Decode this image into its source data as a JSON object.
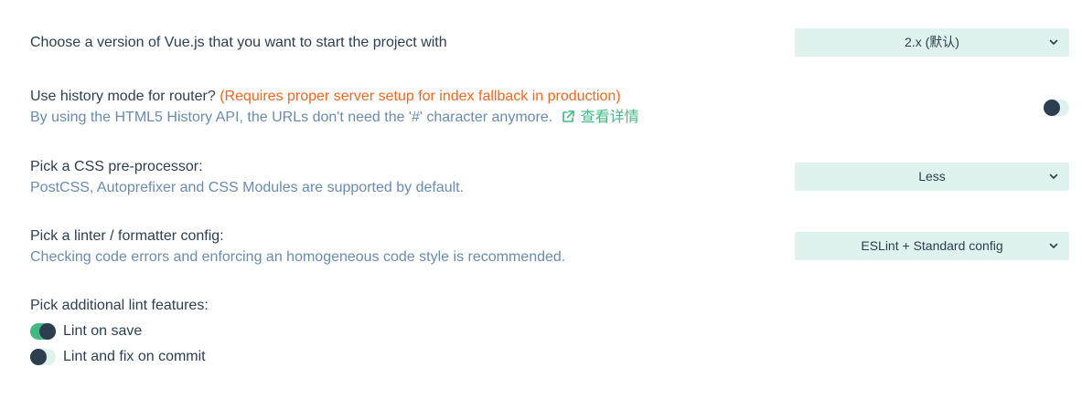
{
  "vue_version": {
    "label": "Choose a version of Vue.js that you want to start the project with",
    "selected": "2.x (默认)"
  },
  "history_mode": {
    "label": "Use history mode for router?",
    "warning": "(Requires proper server setup for index fallback in production)",
    "description": "By using the HTML5 History API, the URLs don't need the '#' character anymore.",
    "link_text": "查看详情",
    "enabled": false
  },
  "css_preprocessor": {
    "label": "Pick a CSS pre-processor:",
    "description": "PostCSS, Autoprefixer and CSS Modules are supported by default.",
    "selected": "Less"
  },
  "linter": {
    "label": "Pick a linter / formatter config:",
    "description": "Checking code errors and enforcing an homogeneous code style is recommended.",
    "selected": "ESLint + Standard config"
  },
  "lint_features": {
    "label": "Pick additional lint features:",
    "options": [
      {
        "label": "Lint on save",
        "checked": true
      },
      {
        "label": "Lint and fix on commit",
        "checked": false
      }
    ]
  },
  "colors": {
    "accent": "#42b983",
    "text": "#2c3e50",
    "description": "#6a8bad",
    "warning": "#f5661f",
    "select_bg": "#e0f2ed"
  }
}
